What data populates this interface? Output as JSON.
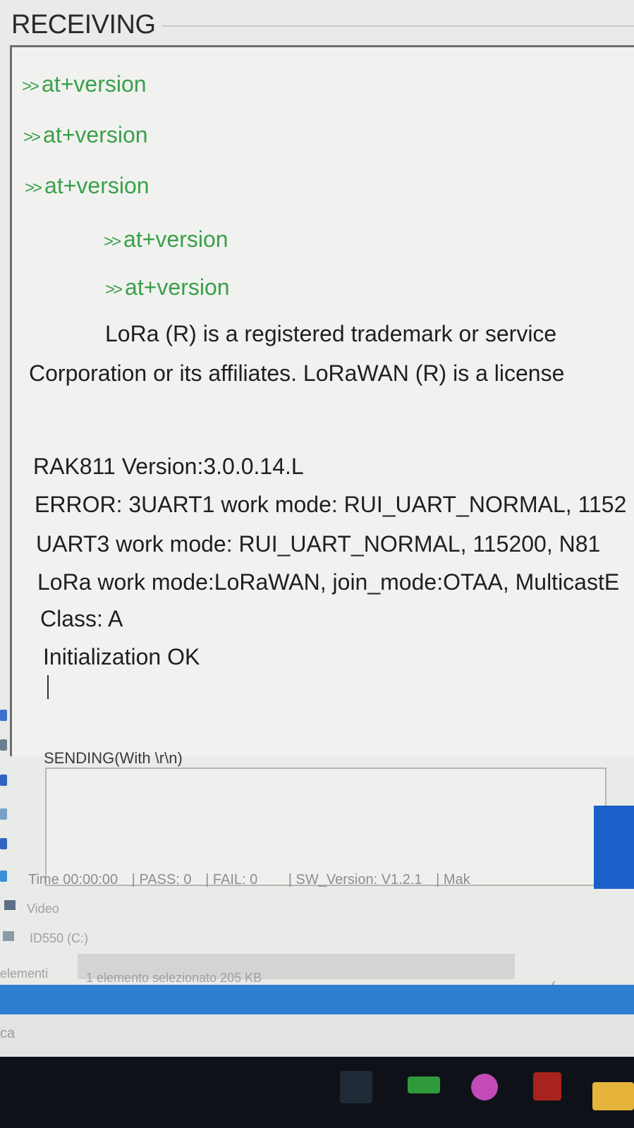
{
  "receiving": {
    "title": "RECEIVING",
    "lines": [
      {
        "prompt": ">>",
        "text": "at+version"
      },
      {
        "prompt": ">>",
        "text": "at+version"
      },
      {
        "prompt": ">>",
        "text": "at+version"
      },
      {
        "prompt": ">>",
        "text": "at+version"
      },
      {
        "prompt": ">>",
        "text": "at+version"
      },
      {
        "text": "LoRa (R) is a registered trademark or service"
      },
      {
        "text": "Corporation or its affiliates. LoRaWAN (R) is a license"
      },
      {
        "text": "RAK811 Version:3.0.0.14.L"
      },
      {
        "text": "ERROR: 3UART1 work mode: RUI_UART_NORMAL, 1152"
      },
      {
        "text": "UART3 work mode: RUI_UART_NORMAL, 115200, N81"
      },
      {
        "text": "LoRa work mode:LoRaWAN, join_mode:OTAA, MulticastE"
      },
      {
        "text": "Class: A"
      },
      {
        "text": "Initialization OK"
      }
    ]
  },
  "sending": {
    "label": "SENDING(With \\r\\n)",
    "value": ""
  },
  "status": {
    "time": "Time 00:00:00",
    "pass": "| PASS: 0",
    "fail": "| FAIL: 0",
    "sw_version": "| SW_Version: V1.2.1",
    "make": "| Mak"
  },
  "explorer": {
    "video": "Video",
    "drive": "ID550 (C:)",
    "items": "elementi",
    "selected": "1 elemento selezionato  205 KB",
    "search": "ca"
  },
  "colors": {
    "green_text": "#3aa04a",
    "send_button": "#1b5fc8",
    "taskbar": "#0e1218"
  }
}
